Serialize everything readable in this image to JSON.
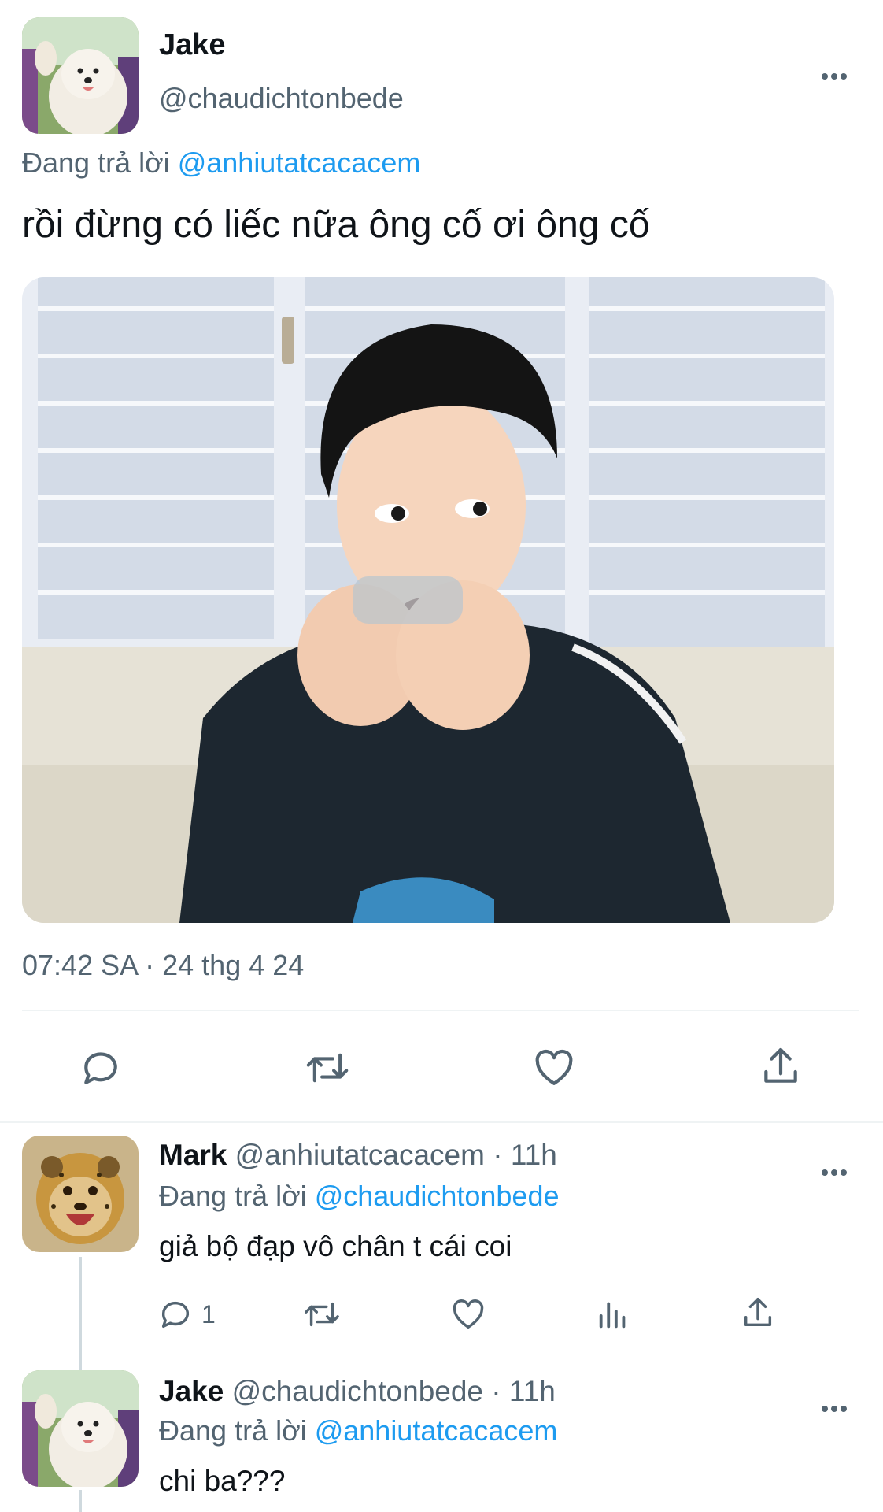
{
  "main_tweet": {
    "author_name": "Jake",
    "author_handle": "@chaudichtonbede",
    "reply_prefix": "Đang trả lời",
    "reply_to": "@anhiutatcacacem",
    "text": "rồi đừng có liếc nữa ông cố ơi ông cố",
    "timestamp": "07:42 SA · 24 thg 4 24",
    "media_alt": "photo of a young man eating",
    "icons": [
      "reply-icon",
      "retweet-icon",
      "like-icon",
      "share-icon"
    ]
  },
  "replies": [
    {
      "author_name": "Mark",
      "author_handle": "@anhiutatcacacem · 11h",
      "reply_prefix": "Đang trả lời",
      "reply_to": "@chaudichtonbede",
      "text": "giả bộ đạp vô chân t cái coi",
      "reply_count": "1",
      "icons": [
        "reply-icon",
        "retweet-icon",
        "like-icon",
        "views-icon",
        "share-icon"
      ]
    },
    {
      "author_name": "Jake",
      "author_handle": "@chaudichtonbede · 11h",
      "reply_prefix": "Đang trả lời",
      "reply_to": "@anhiutatcacacem",
      "text": "chi ba???"
    }
  ],
  "colors": {
    "accent": "#1d9bf0",
    "text": "#0f1419",
    "muted": "#536471",
    "divider": "#eff3f4"
  }
}
